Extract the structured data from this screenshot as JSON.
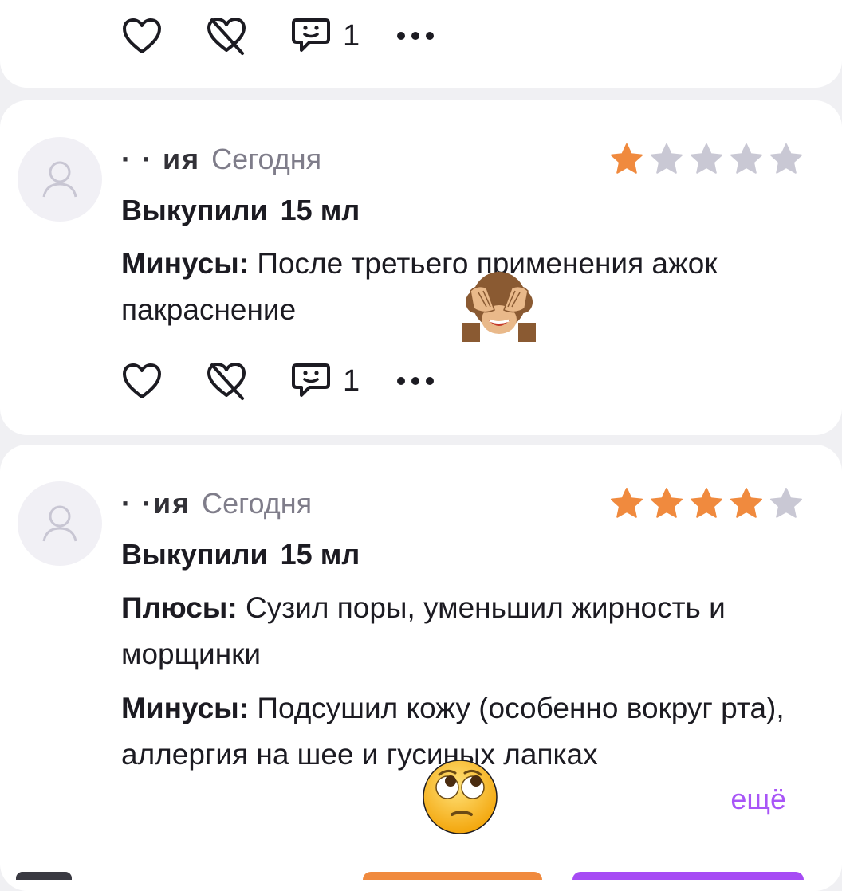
{
  "icons": {
    "like": "heart-icon",
    "dislike": "broken-heart-icon",
    "comments": "comment-smile-icon",
    "more": "more-dots-icon",
    "avatar": "user-avatar-icon",
    "star": "star-icon"
  },
  "colors": {
    "star_active": "#f08a3e",
    "star_inactive": "#c9c8d4",
    "more_link": "#a855f7",
    "date": "#7f7d8a"
  },
  "top_card": {
    "comment_count": "1"
  },
  "reviews": [
    {
      "author": "· · ия",
      "date": "Сегодня",
      "rating": 1,
      "purchase_label": "Выкупили",
      "purchase_volume": "15 мл",
      "cons_label": "Минусы:",
      "cons_text": "После третьего применения ажок пакраснение",
      "comment_count": "1"
    },
    {
      "author": "· ·ия",
      "date": "Сегодня",
      "rating": 4,
      "purchase_label": "Выкупили",
      "purchase_volume": "15 мл",
      "pros_label": "Плюсы:",
      "pros_text": "Сузил поры, уменьшил жирность и морщинки",
      "cons_label": "Минусы:",
      "cons_text": "Подсушил кожу (особенно вокруг рта), аллергия на шее и гусиных лапках",
      "more_label": "ещё"
    }
  ]
}
